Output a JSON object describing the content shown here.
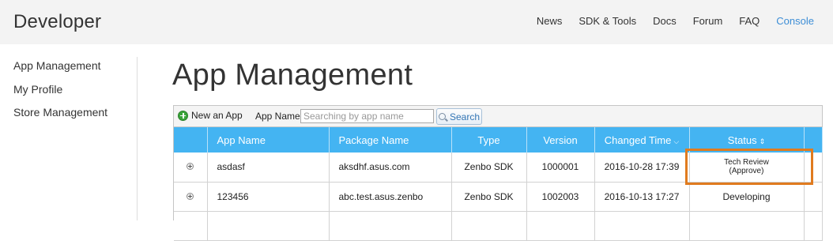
{
  "header": {
    "brand": "Developer",
    "nav": [
      "News",
      "SDK & Tools",
      "Docs",
      "Forum",
      "FAQ",
      "Console"
    ]
  },
  "sidebar": {
    "items": [
      "App Management",
      "My Profile",
      "Store Management"
    ]
  },
  "page_title": "App Management",
  "toolbar": {
    "new_app_label": "New an App",
    "app_name_label": "App Name",
    "search_placeholder": "Searching by app name",
    "search_button": "Search"
  },
  "table": {
    "columns": [
      "App Name",
      "Package Name",
      "Type",
      "Version",
      "Changed Time",
      "Status"
    ],
    "sort_icons": {
      "changed_time": "⌵",
      "status": "⇕"
    },
    "rows": [
      {
        "app_name": "asdasf",
        "package": "aksdhf.asus.com",
        "type": "Zenbo SDK",
        "version": "1000001",
        "changed": "2016-10-28 17:39",
        "status_line1": "Tech Review",
        "status_line2": "(Approve)"
      },
      {
        "app_name": "123456",
        "package": "abc.test.asus.zenbo",
        "type": "Zenbo SDK",
        "version": "1002003",
        "changed": "2016-10-13 17:27",
        "status": "Developing"
      }
    ]
  },
  "colors": {
    "accent": "#3d8ed6",
    "header_blue": "#44b4f2",
    "highlight": "#e07b1f"
  }
}
